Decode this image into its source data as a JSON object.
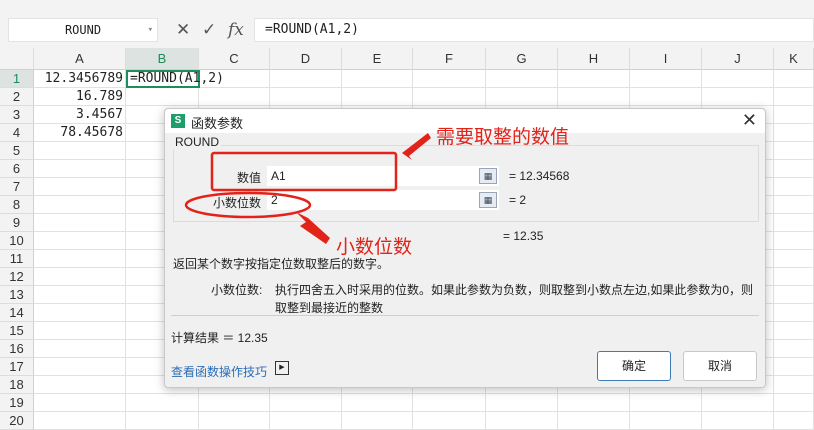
{
  "formula_bar": {
    "name_box": "ROUND",
    "cancel": "✕",
    "confirm": "✓",
    "fx": "fx",
    "formula": "=ROUND(A1,2)"
  },
  "columns": [
    "A",
    "B",
    "C",
    "D",
    "E",
    "F",
    "G",
    "H",
    "I",
    "J",
    "K"
  ],
  "rows": [
    "1",
    "2",
    "3",
    "4",
    "5",
    "6",
    "7",
    "8",
    "9",
    "10",
    "11",
    "12",
    "13",
    "14",
    "15",
    "16",
    "17",
    "18",
    "19",
    "20"
  ],
  "cells": {
    "A1": "12.3456789",
    "A2": "16.789",
    "A3": "3.4567",
    "A4": "78.45678",
    "B1": "=ROUND(A1,2)"
  },
  "dialog": {
    "logo": "S",
    "title": "函数参数",
    "close": "✕",
    "function_name": "ROUND",
    "params": [
      {
        "label": "数值",
        "value": "A1",
        "result": "= 12.34568"
      },
      {
        "label": "小数位数",
        "value": "2",
        "result": "= 2"
      }
    ],
    "formula_result": "= 12.35",
    "description": "返回某个数字按指定位数取整后的数字。",
    "param_help_label": "小数位数:",
    "param_help_line1": "执行四舍五入时采用的位数。如果此参数为负数，则取整到小数点左边,如果此参数为0，则",
    "param_help_line2": "取整到最接近的整数",
    "calc_result": "计算结果 ＝  12.35",
    "help_link": "查看函数操作技巧",
    "ok": "确定",
    "cancel": "取消"
  },
  "annotations": {
    "value_note": "需要取整的数值",
    "digits_note": "小数位数"
  },
  "colors": {
    "accent": "#1f9d6b",
    "annotation": "#e2231a",
    "link": "#2a6db5"
  }
}
